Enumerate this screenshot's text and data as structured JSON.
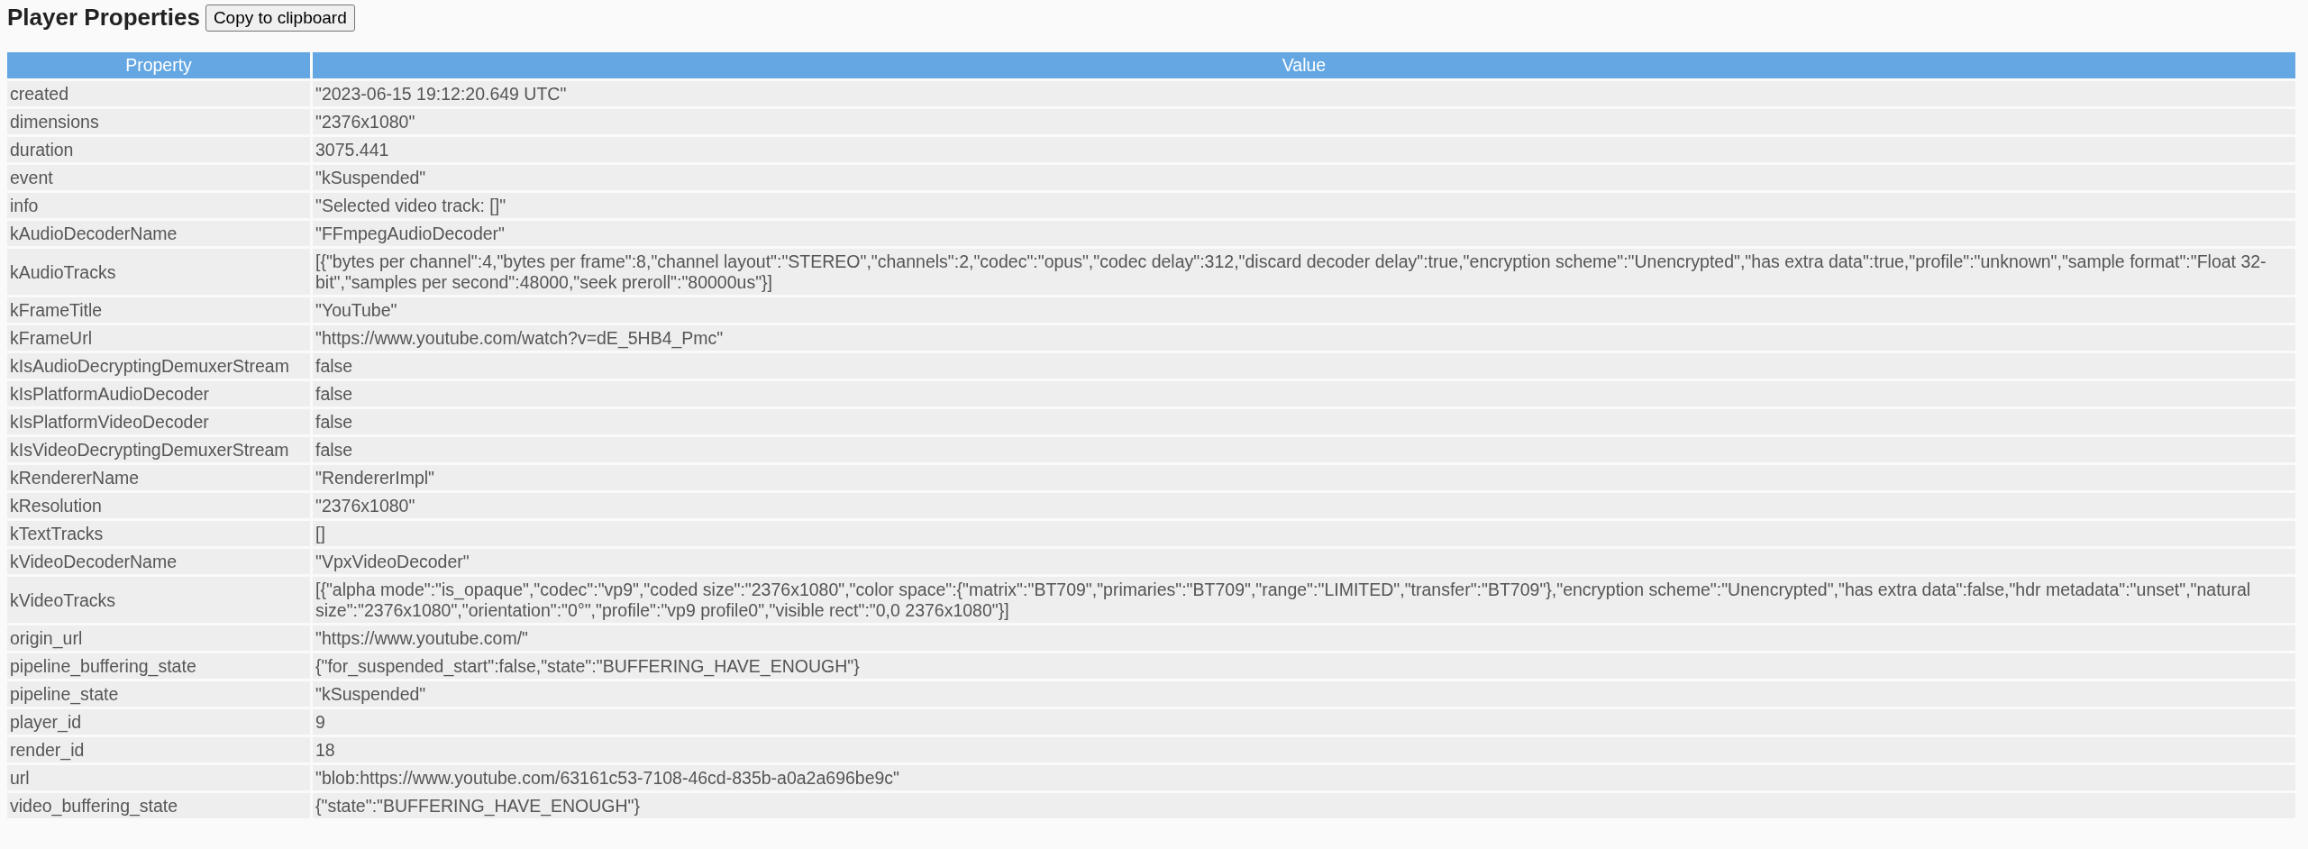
{
  "title": "Player Properties",
  "copy_button": "Copy to clipboard",
  "table": {
    "columns": [
      "Property",
      "Value"
    ],
    "rows": [
      {
        "property": "created",
        "value": "\"2023-06-15 19:12:20.649 UTC\""
      },
      {
        "property": "dimensions",
        "value": "\"2376x1080\""
      },
      {
        "property": "duration",
        "value": "3075.441"
      },
      {
        "property": "event",
        "value": "\"kSuspended\""
      },
      {
        "property": "info",
        "value": "\"Selected video track: []\""
      },
      {
        "property": "kAudioDecoderName",
        "value": "\"FFmpegAudioDecoder\""
      },
      {
        "property": "kAudioTracks",
        "value": "[{\"bytes per channel\":4,\"bytes per frame\":8,\"channel layout\":\"STEREO\",\"channels\":2,\"codec\":\"opus\",\"codec delay\":312,\"discard decoder delay\":true,\"encryption scheme\":\"Unencrypted\",\"has extra data\":true,\"profile\":\"unknown\",\"sample format\":\"Float 32-bit\",\"samples per second\":48000,\"seek preroll\":\"80000us\"}]"
      },
      {
        "property": "kFrameTitle",
        "value": "\"YouTube\""
      },
      {
        "property": "kFrameUrl",
        "value": "\"https://www.youtube.com/watch?v=dE_5HB4_Pmc\""
      },
      {
        "property": "kIsAudioDecryptingDemuxerStream",
        "value": "false"
      },
      {
        "property": "kIsPlatformAudioDecoder",
        "value": "false"
      },
      {
        "property": "kIsPlatformVideoDecoder",
        "value": "false"
      },
      {
        "property": "kIsVideoDecryptingDemuxerStream",
        "value": "false"
      },
      {
        "property": "kRendererName",
        "value": "\"RendererImpl\""
      },
      {
        "property": "kResolution",
        "value": "\"2376x1080\""
      },
      {
        "property": "kTextTracks",
        "value": "[]"
      },
      {
        "property": "kVideoDecoderName",
        "value": "\"VpxVideoDecoder\""
      },
      {
        "property": "kVideoTracks",
        "value": "[{\"alpha mode\":\"is_opaque\",\"codec\":\"vp9\",\"coded size\":\"2376x1080\",\"color space\":{\"matrix\":\"BT709\",\"primaries\":\"BT709\",\"range\":\"LIMITED\",\"transfer\":\"BT709\"},\"encryption scheme\":\"Unencrypted\",\"has extra data\":false,\"hdr metadata\":\"unset\",\"natural size\":\"2376x1080\",\"orientation\":\"0°\",\"profile\":\"vp9 profile0\",\"visible rect\":\"0,0 2376x1080\"}]"
      },
      {
        "property": "origin_url",
        "value": "\"https://www.youtube.com/\""
      },
      {
        "property": "pipeline_buffering_state",
        "value": "{\"for_suspended_start\":false,\"state\":\"BUFFERING_HAVE_ENOUGH\"}"
      },
      {
        "property": "pipeline_state",
        "value": "\"kSuspended\""
      },
      {
        "property": "player_id",
        "value": "9"
      },
      {
        "property": "render_id",
        "value": "18"
      },
      {
        "property": "url",
        "value": "\"blob:https://www.youtube.com/63161c53-7108-46cd-835b-a0a2a696be9c\""
      },
      {
        "property": "video_buffering_state",
        "value": "{\"state\":\"BUFFERING_HAVE_ENOUGH\"}"
      }
    ]
  }
}
